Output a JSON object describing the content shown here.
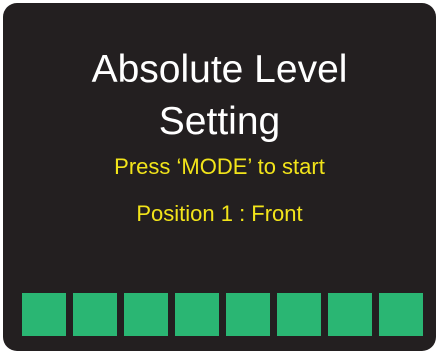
{
  "display": {
    "title_line1": "Absolute Level",
    "title_line2": "Setting",
    "instruction": "Press ‘MODE’ to start",
    "position": "Position 1 : Front"
  },
  "level_bar": {
    "segment_count": 8,
    "lit_segments": 8,
    "color": "#2ab673"
  },
  "colors": {
    "background": "#231f20",
    "title": "#ffffff",
    "text_accent": "#f2e41a"
  }
}
